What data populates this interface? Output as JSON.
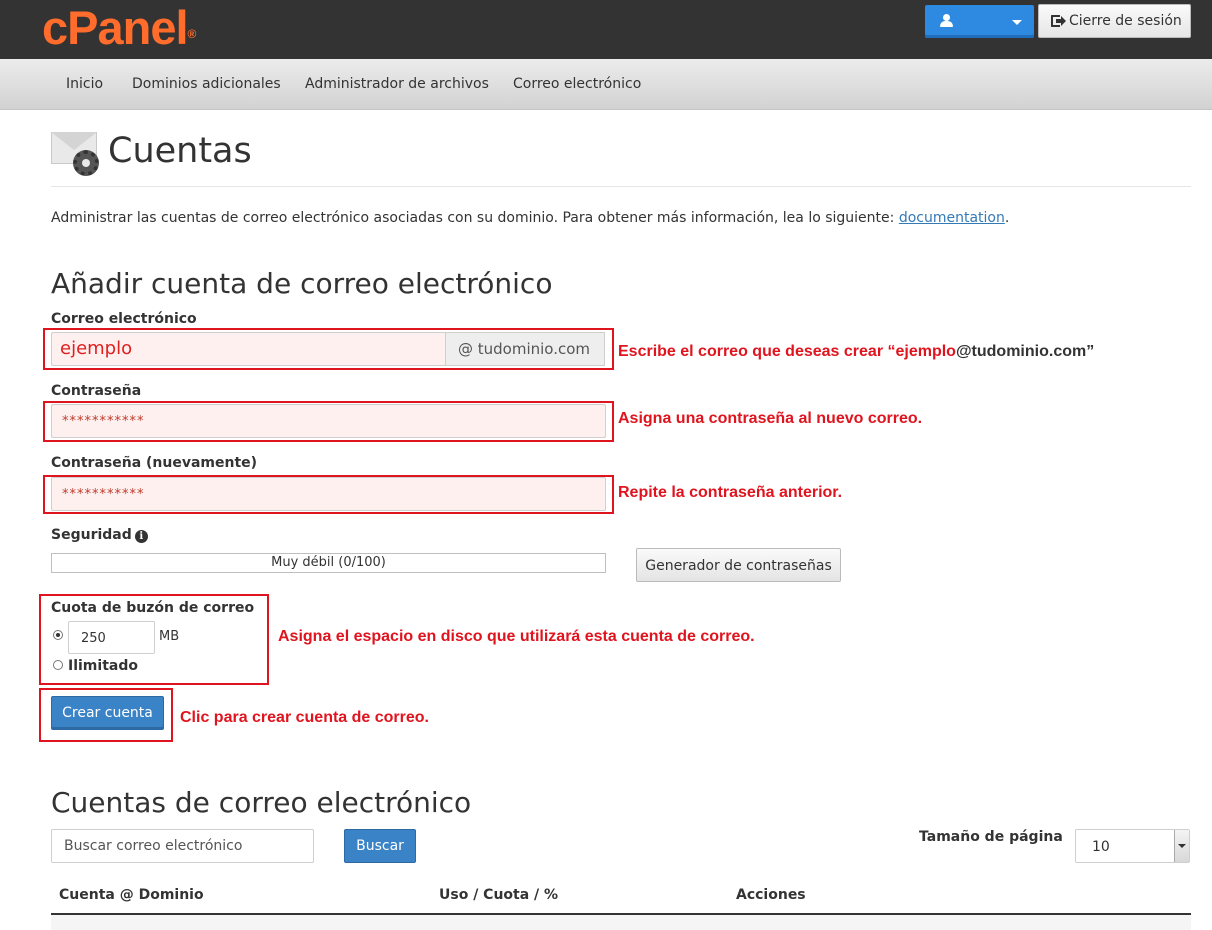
{
  "header": {
    "logo_text": "cPanel",
    "logo_mark": "®",
    "user_icon": "user-icon",
    "logout_label": "Cierre de sesión",
    "logout_icon": "sign-out-icon",
    "brand_color": "#ff6c2c",
    "accent_color": "#2e8ae0"
  },
  "nav": {
    "items": [
      "Inicio",
      "Dominios adicionales",
      "Administrador de archivos",
      "Correo electrónico"
    ]
  },
  "page": {
    "title": "Cuentas",
    "title_icon": "email-accounts-gear-icon",
    "description": "Administrar las cuentas de correo electrónico asociadas con su dominio. Para obtener más información, lea lo siguiente: ",
    "doc_link": "documentation",
    "description_end": "."
  },
  "add_form": {
    "title": "Añadir cuenta de correo electrónico",
    "email_label": "Correo electrónico",
    "email_value": "ejemplo",
    "domain_addon": "@ tudominio.com",
    "password_label": "Contraseña",
    "password_value": "***********",
    "password_confirm_label": "Contraseña (nuevamente)",
    "password_confirm_value": "***********",
    "security_label": "Seguridad",
    "strength_text": "Muy débil (0/100)",
    "strength_value": 0,
    "generator_label": "Generador de contraseñas",
    "quota_label": "Cuota de buzón de correo",
    "quota_value": "250",
    "quota_unit": "MB",
    "quota_selected": "custom",
    "unlimited_label": "Ilimitado",
    "create_label": "Crear cuenta"
  },
  "annotations": {
    "email_note_prefix": "Escribe el correo que deseas crear “ejemplo",
    "email_note_suffix": "@tudominio.com”",
    "password_note": "Asigna una contraseña al nuevo correo.",
    "repeat_note": "Repite la contraseña anterior.",
    "quota_note": "Asigna el espacio en disco que utilizará esta cuenta de correo.",
    "create_note": "Clic para crear cuenta de correo.",
    "highlight_color": "#e0141e"
  },
  "accounts": {
    "title": "Cuentas de correo electrónico",
    "search_placeholder": "Buscar correo electrónico",
    "search_button": "Buscar",
    "page_size_label": "Tamaño de página",
    "page_size_value": "10",
    "columns": [
      "Cuenta @ Dominio",
      "Uso / Cuota / %",
      "Acciones"
    ]
  }
}
